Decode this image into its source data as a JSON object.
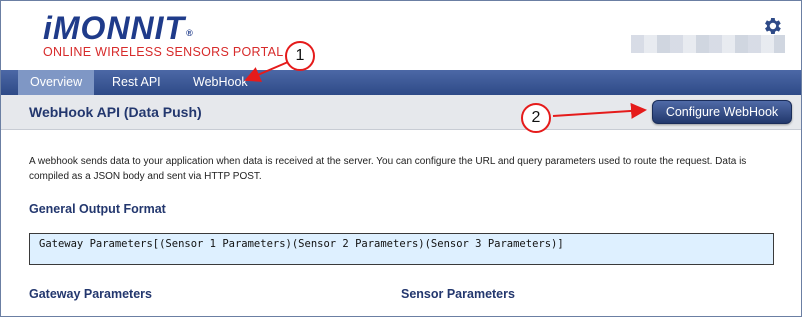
{
  "header": {
    "logo_text": "iMONNIT",
    "logo_reg": "®",
    "tagline": "ONLINE WIRELESS SENSORS PORTAL",
    "settings_icon": "gear-icon"
  },
  "nav": {
    "tabs": [
      {
        "label": "Overview",
        "active": true
      },
      {
        "label": "Rest API",
        "active": false
      },
      {
        "label": "WebHook",
        "active": false
      }
    ]
  },
  "titlebar": {
    "title": "WebHook API (Data Push)",
    "configure_label": "Configure WebHook"
  },
  "content": {
    "description": "A webhook sends data to your application when data is received at the server. You can configure the URL and query parameters used to route the request. Data is compiled as a JSON body and sent via HTTP POST.",
    "general_output_title": "General Output Format",
    "code_sample": "Gateway Parameters[(Sensor 1 Parameters)(Sensor 2 Parameters)(Sensor 3 Parameters)]",
    "gateway_params_title": "Gateway Parameters",
    "sensor_params_title": "Sensor Parameters"
  },
  "annotations": [
    {
      "number": "1"
    },
    {
      "number": "2"
    }
  ],
  "colors": {
    "brand_blue": "#1f3b8a",
    "tagline_red": "#d72b2b",
    "nav_blue": "#2e4a87",
    "annotation_red": "#e51b1b",
    "code_bg": "#def0ff"
  }
}
